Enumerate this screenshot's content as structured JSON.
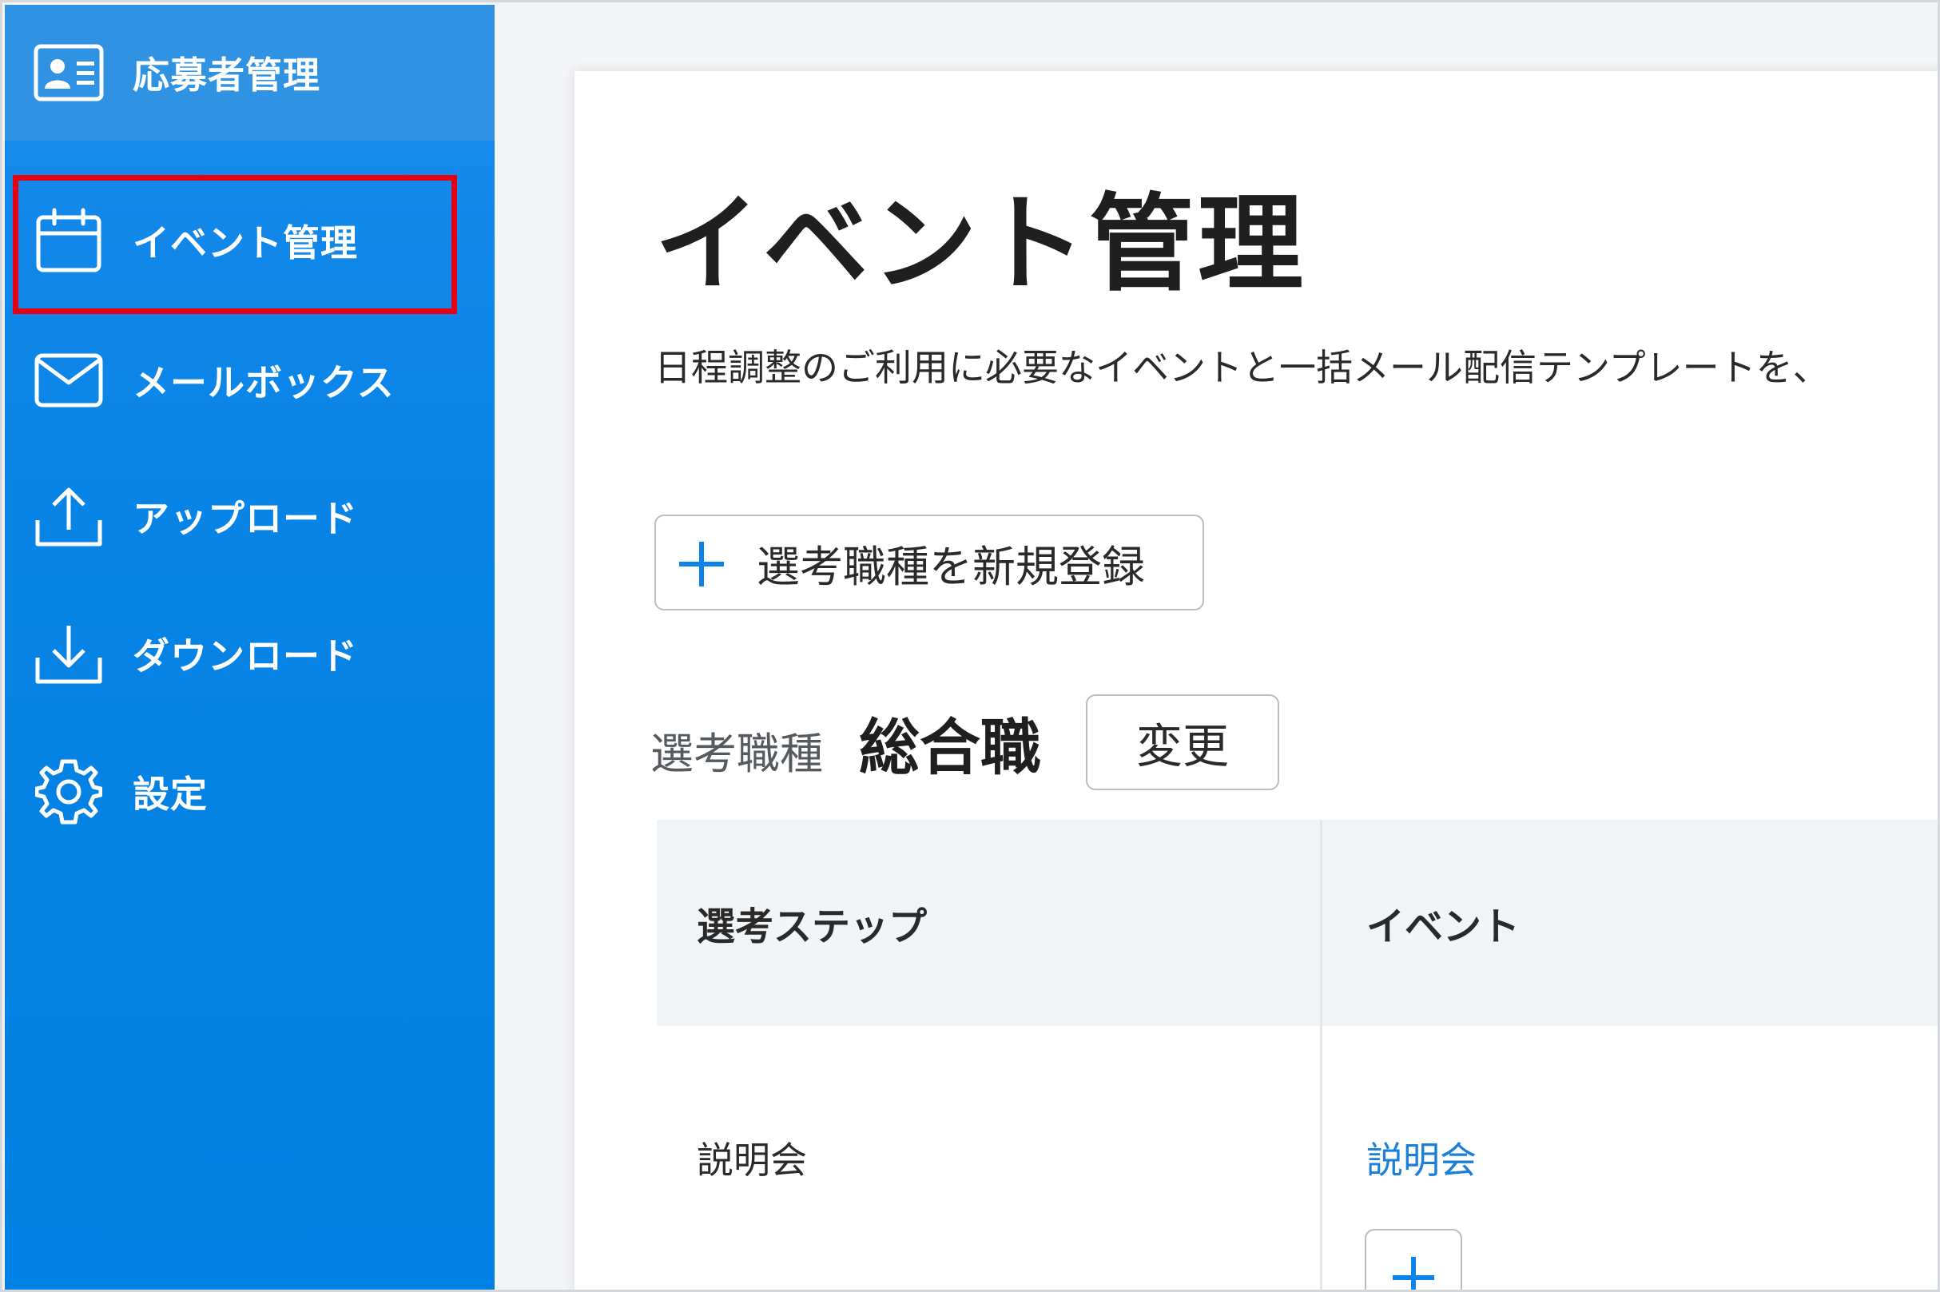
{
  "sidebar": {
    "items": [
      {
        "label": "応募者管理",
        "icon": "id-card-icon"
      },
      {
        "label": "イベント管理",
        "icon": "calendar-icon"
      },
      {
        "label": "メールボックス",
        "icon": "mail-icon"
      },
      {
        "label": "アップロード",
        "icon": "upload-icon"
      },
      {
        "label": "ダウンロード",
        "icon": "download-icon"
      },
      {
        "label": "設定",
        "icon": "gear-icon"
      }
    ],
    "colors": {
      "background": "#0080e2",
      "active_top": "#2f92e2",
      "highlight_border": "#e60012"
    }
  },
  "main": {
    "title": "イベント管理",
    "description": "日程調整のご利用に必要なイベントと一括メール配信テンプレートを、",
    "add_job_button": "選考職種を新規登録",
    "job_type_label": "選考職種",
    "job_type_value": "総合職",
    "change_button": "変更",
    "table": {
      "headers": [
        "選考ステップ",
        "イベント"
      ],
      "rows": [
        {
          "step": "説明会",
          "event": "説明会"
        }
      ]
    },
    "colors": {
      "link": "#1a7fd8",
      "accent": "#0a84e8"
    }
  }
}
